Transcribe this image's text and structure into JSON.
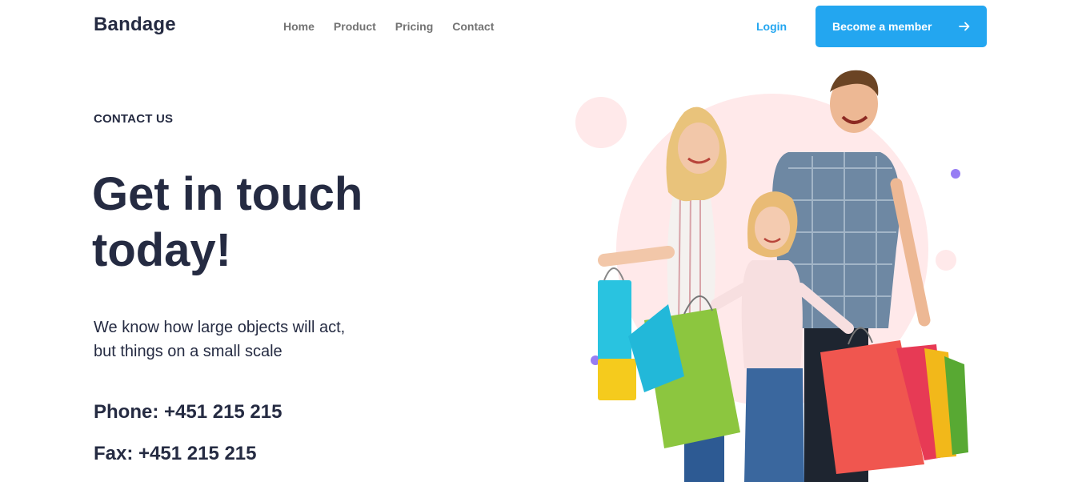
{
  "nav": {
    "brand": "Bandage",
    "links": [
      "Home",
      "Product",
      "Pricing",
      "Contact"
    ],
    "login": "Login",
    "cta": "Become a member"
  },
  "hero": {
    "eyebrow": "CONTACT US",
    "headline_line1": "Get in touch",
    "headline_line2": "today!",
    "subtext_line1": "We know how large objects will act,",
    "subtext_line2": "but things on a small scale",
    "phone": "Phone: +451 215 215",
    "fax": "Fax: +451 215 215",
    "image_alt": "family-shopping-photo"
  },
  "colors": {
    "primary": "#23a6f0",
    "heading": "#252b42",
    "muted": "#737373",
    "pink_circle": "#ffe9ea",
    "purple_dot": "#977df4"
  }
}
